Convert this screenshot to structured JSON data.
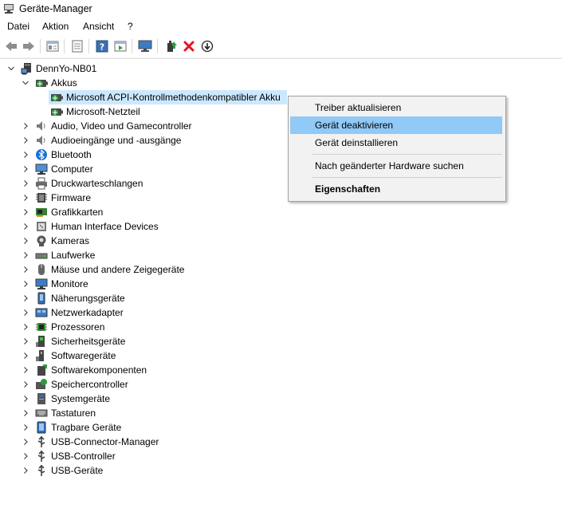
{
  "window": {
    "title": "Geräte-Manager"
  },
  "menu": [
    "Datei",
    "Aktion",
    "Ansicht",
    "?"
  ],
  "toolbar": {
    "icons": [
      "back-icon",
      "forward-icon",
      "properties-view-icon",
      "show-hidden-icon",
      "help-icon",
      "action-pane-icon",
      "monitor-icon",
      "update-driver-icon",
      "uninstall-icon",
      "disable-device-icon"
    ]
  },
  "tree": {
    "root": "DennYo-NB01",
    "akkus": {
      "label": "Akkus",
      "children": [
        "Microsoft ACPI-Kontrollmethodenkompatibler Akku",
        "Microsoft-Netzteil"
      ]
    },
    "categories": [
      "Audio, Video und Gamecontroller",
      "Audioeingänge und -ausgänge",
      "Bluetooth",
      "Computer",
      "Druckwarteschlangen",
      "Firmware",
      "Grafikkarten",
      "Human Interface Devices",
      "Kameras",
      "Laufwerke",
      "Mäuse und andere Zeigegeräte",
      "Monitore",
      "Näherungsgeräte",
      "Netzwerkadapter",
      "Prozessoren",
      "Sicherheitsgeräte",
      "Softwaregeräte",
      "Softwarekomponenten",
      "Speichercontroller",
      "Systemgeräte",
      "Tastaturen",
      "Tragbare Geräte",
      "USB-Connector-Manager",
      "USB-Controller",
      "USB-Geräte"
    ]
  },
  "context_menu": {
    "items": [
      "Treiber aktualisieren",
      "Gerät deaktivieren",
      "Gerät deinstallieren",
      "Nach geänderter Hardware suchen",
      "Eigenschaften"
    ],
    "highlighted": "Gerät deaktivieren"
  },
  "colors": {
    "selection": "#cce8ff",
    "menu_highlight": "#91c9f7",
    "delete_red": "#e81123"
  }
}
